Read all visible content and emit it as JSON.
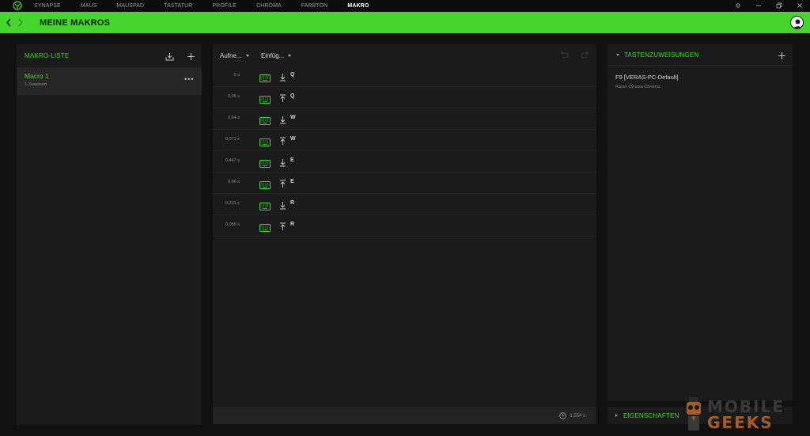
{
  "topnav": {
    "tabs": [
      {
        "label": "SYNAPSE"
      },
      {
        "label": "MAUS"
      },
      {
        "label": "MAUSPAD"
      },
      {
        "label": "TASTATUR"
      },
      {
        "label": "PROFILE"
      },
      {
        "label": "CHROMA"
      },
      {
        "label": "FARBTON"
      },
      {
        "label": "MAKRO"
      }
    ],
    "active_tab": "MAKRO",
    "window_controls": [
      "settings-icon",
      "minimize-icon",
      "restore-icon",
      "close-icon"
    ]
  },
  "header": {
    "title": "MEINE MAKROS",
    "accent_color": "#44d62c"
  },
  "macro_list": {
    "title": "MAKRO-LISTE",
    "items": [
      {
        "name": "Macro 1",
        "subtitle": "1 Zuweisen"
      }
    ]
  },
  "editor": {
    "columns": [
      "Aufne...",
      "Einfüg..."
    ],
    "rows": [
      {
        "time": "0 s",
        "direction": "down",
        "key": "Q"
      },
      {
        "time": "0,05 s",
        "direction": "up",
        "key": "Q"
      },
      {
        "time": "0,64 s",
        "direction": "down",
        "key": "W"
      },
      {
        "time": "0,071 s",
        "direction": "up",
        "key": "W"
      },
      {
        "time": "0,447 s",
        "direction": "down",
        "key": "E"
      },
      {
        "time": "0,06 s",
        "direction": "up",
        "key": "E"
      },
      {
        "time": "0,231 s",
        "direction": "down",
        "key": "R"
      },
      {
        "time": "0,055 s",
        "direction": "up",
        "key": "R"
      }
    ],
    "total_duration": "1,554 s"
  },
  "assignments": {
    "title": "TASTENZUWEISUNGEN",
    "items": [
      {
        "name": "F9 [VERAS-PC-Default]",
        "device": "Razer Cynosa Chroma"
      }
    ]
  },
  "properties": {
    "title": "EIGENSCHAFTEN"
  },
  "watermark": {
    "line1": "MOBILE",
    "line2": "GEEKS"
  }
}
